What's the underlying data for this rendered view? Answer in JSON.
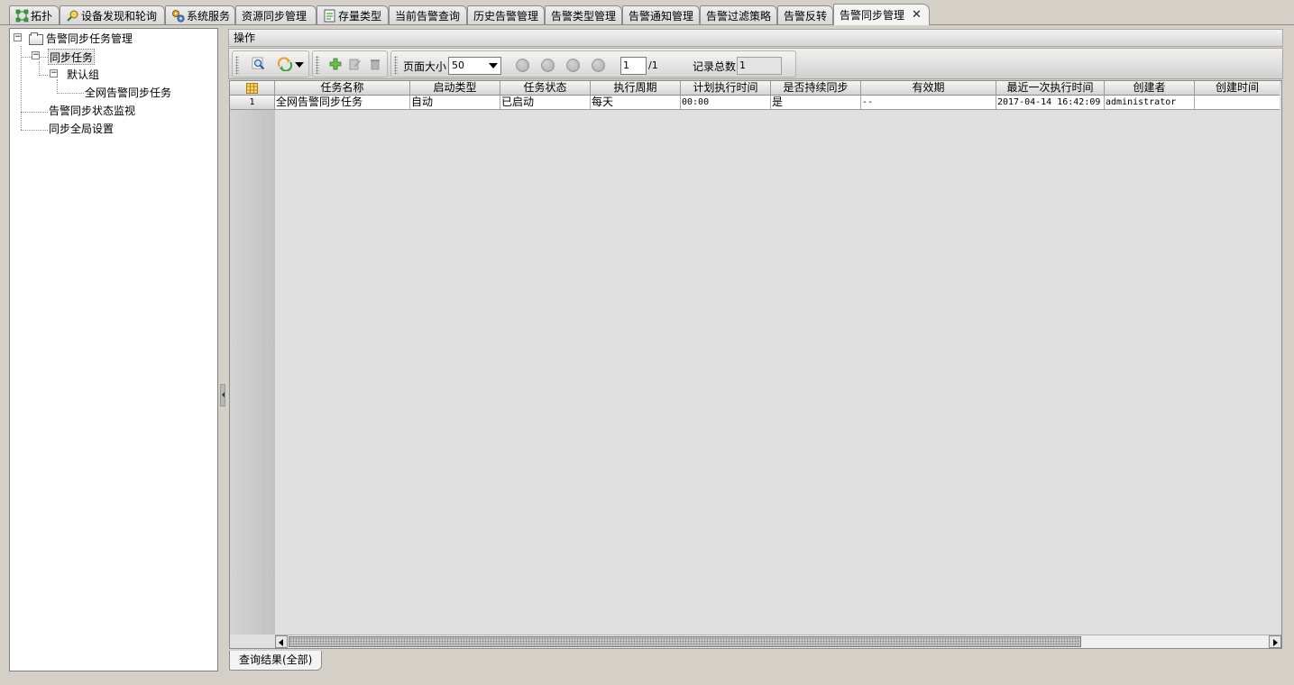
{
  "tabs": [
    {
      "label": "拓扑",
      "icon": "topology-icon"
    },
    {
      "label": "设备发现和轮询",
      "icon": "discovery-icon"
    },
    {
      "label": "系统服务",
      "icon": "gears-icon"
    },
    {
      "label": "资源同步管理",
      "icon": ""
    },
    {
      "label": "存量类型",
      "icon": "inventory-icon"
    },
    {
      "label": "当前告警查询",
      "icon": ""
    },
    {
      "label": "历史告警管理",
      "icon": ""
    },
    {
      "label": "告警类型管理",
      "icon": ""
    },
    {
      "label": "告警通知管理",
      "icon": ""
    },
    {
      "label": "告警过滤策略",
      "icon": ""
    },
    {
      "label": "告警反转",
      "icon": ""
    },
    {
      "label": "告警同步管理",
      "icon": "",
      "active": true
    }
  ],
  "tab_close_glyph": "✕",
  "tree": {
    "root": "告警同步任务管理",
    "sync_tasks": "同步任务",
    "default_group": "默认组",
    "network_task": "全网告警同步任务",
    "status_monitor": "告警同步状态监视",
    "global_settings": "同步全局设置",
    "toggle_glyph": "−"
  },
  "panel": {
    "header": "操作"
  },
  "toolbar": {
    "page_size_label": "页面大小",
    "page_size_value": "50",
    "current_page": "1",
    "total_pages": "/1",
    "record_count_label": "记录总数",
    "record_count_value": "1"
  },
  "grid": {
    "columns": [
      "任务名称",
      "启动类型",
      "任务状态",
      "执行周期",
      "计划执行时间",
      "是否持续同步",
      "有效期",
      "最近一次执行时间",
      "创建者",
      "创建时间"
    ],
    "rows": [
      {
        "num": "1",
        "cells": [
          "全网告警同步任务",
          "自动",
          "已启动",
          "每天",
          "00:00",
          "是",
          "--",
          "2017-04-14 16:42:09",
          "administrator",
          ""
        ]
      }
    ]
  },
  "bottom_tab": "查询结果(全部)",
  "colors": {
    "background": "#d4d0c8",
    "accent_green": "#3aa23a",
    "toolbar_orange": "#e8a020"
  }
}
